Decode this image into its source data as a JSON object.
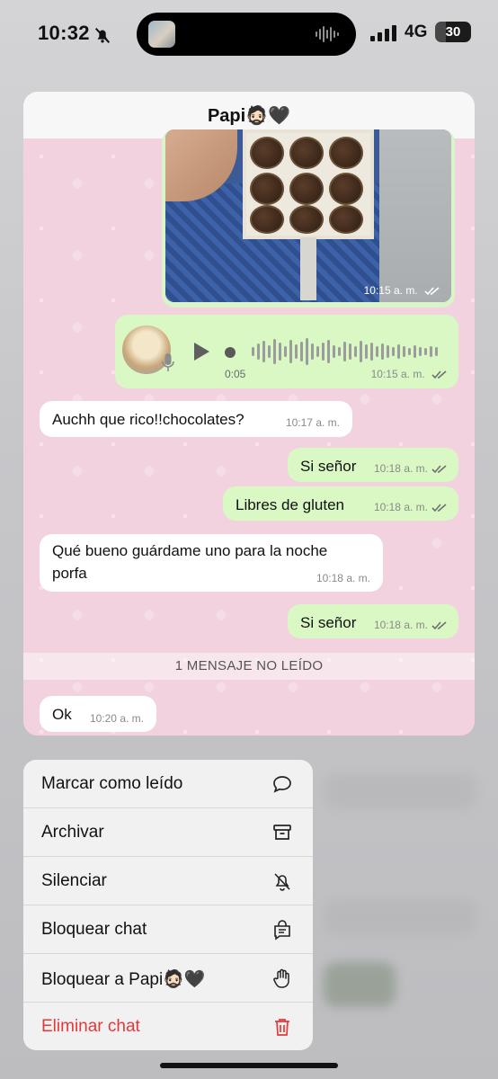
{
  "status": {
    "time": "10:32",
    "network": "4G",
    "battery": "30",
    "battery_level": 0.3
  },
  "chat": {
    "title": "Papi🧔🏻🖤",
    "photo_time": "10:15 a. m.",
    "voice": {
      "duration": "0:05",
      "time": "10:15 a. m."
    },
    "messages": [
      {
        "dir": "in",
        "text": "Auchh que rico!!chocolates?",
        "time": "10:17 a. m."
      },
      {
        "dir": "out",
        "text": "Si señor",
        "time": "10:18 a. m."
      },
      {
        "dir": "out",
        "text": "Libres de gluten",
        "time": "10:18 a. m."
      },
      {
        "dir": "in",
        "text_line1": "Qué bueno guárdame uno para la noche",
        "text_line2": "porfa",
        "time": "10:18 a. m."
      },
      {
        "dir": "out",
        "text": "Si señor",
        "time": "10:18 a. m."
      },
      {
        "dir": "in",
        "text": "Ok",
        "time": "10:20 a. m."
      }
    ],
    "unread_label": "1 MENSAJE NO LEÍDO"
  },
  "menu": {
    "items": [
      {
        "label": "Marcar como leído",
        "icon": "chat-bubble-icon"
      },
      {
        "label": "Archivar",
        "icon": "archive-icon"
      },
      {
        "label": "Silenciar",
        "icon": "bell-slash-icon"
      },
      {
        "label": "Bloquear chat",
        "icon": "locked-chat-icon"
      },
      {
        "label": "Bloquear a Papi🧔🏻🖤",
        "icon": "hand-icon"
      },
      {
        "label": "Eliminar chat",
        "icon": "trash-icon"
      }
    ],
    "danger_color": "#e5383b"
  },
  "colors": {
    "outgoing_bubble": "#d9f8c4",
    "incoming_bubble": "#ffffff",
    "chat_wallpaper": "#f2d2df"
  }
}
